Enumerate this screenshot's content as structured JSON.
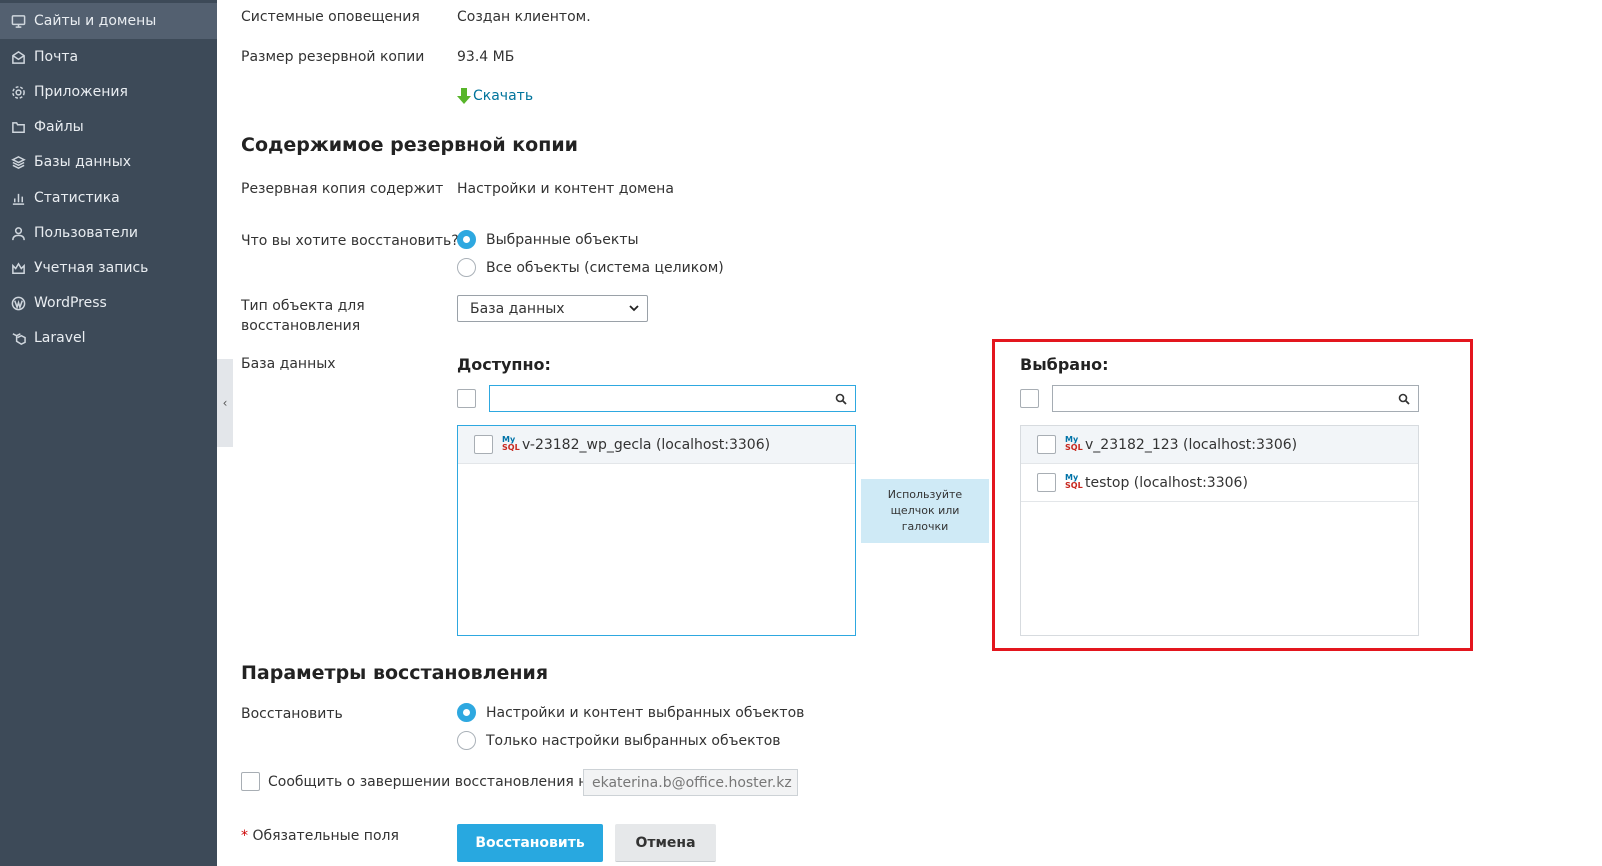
{
  "sidebar": {
    "items": [
      {
        "label": "Сайты и домены",
        "icon": "monitor-icon",
        "active": true
      },
      {
        "label": "Почта",
        "icon": "mail-icon"
      },
      {
        "label": "Приложения",
        "icon": "gear-icon"
      },
      {
        "label": "Файлы",
        "icon": "folder-icon"
      },
      {
        "label": "Базы данных",
        "icon": "layers-icon"
      },
      {
        "label": "Статистика",
        "icon": "bar-chart-icon"
      },
      {
        "label": "Пользователи",
        "icon": "user-icon"
      },
      {
        "label": "Учетная запись",
        "icon": "account-icon"
      },
      {
        "label": "WordPress",
        "icon": "wordpress-icon"
      },
      {
        "label": "Laravel",
        "icon": "laravel-icon"
      }
    ],
    "collapse_glyph": "‹"
  },
  "backup_info": {
    "notifications_label": "Системные оповещения",
    "notifications_value": "Создан клиентом.",
    "size_label": "Размер резервной копии",
    "size_value": "93.4 МБ",
    "download_label": "Скачать"
  },
  "contents": {
    "title": "Содержимое резервной копии",
    "contains_label": "Резервная копия содержит",
    "contains_value": "Настройки и контент домена",
    "restore_what_label": "Что вы хотите восстановить?",
    "restore_options": [
      "Выбранные объекты",
      "Все объекты (система целиком)"
    ],
    "restore_selected_index": 0,
    "object_type_label_line1": "Тип объекта для",
    "object_type_label_line2": "восстановления",
    "object_type_value": "База данных",
    "database_label": "База данных"
  },
  "available": {
    "heading": "Доступно:",
    "search_value": "",
    "items": [
      "v-23182_wp_gecla (localhost:3306)"
    ]
  },
  "hint": {
    "line1": "Используйте",
    "line2": "щелчок или",
    "line3": "галочки"
  },
  "selected": {
    "heading": "Выбрано:",
    "search_value": "",
    "items": [
      "v_23182_123 (localhost:3306)",
      "testop (localhost:3306)"
    ]
  },
  "mysql_logo": {
    "top": "My",
    "bottom": "SQL"
  },
  "restore_params": {
    "title": "Параметры восстановления",
    "restore_label": "Восстановить",
    "options": [
      "Настройки и контент выбранных объектов",
      "Только настройки выбранных объектов"
    ],
    "selected_index": 0,
    "notify_label": "Сообщить о завершении восстановления на",
    "notify_email": "ekaterina.b@office.hoster.kz"
  },
  "footer": {
    "required_star": "*",
    "required_label": "Обязательные поля",
    "restore_button": "Восстановить",
    "cancel_button": "Отмена"
  },
  "colors": {
    "sidebar_bg": "#3d4a58",
    "accent": "#28a8e0",
    "highlight_box": "#e3161e",
    "link": "#00749c"
  }
}
